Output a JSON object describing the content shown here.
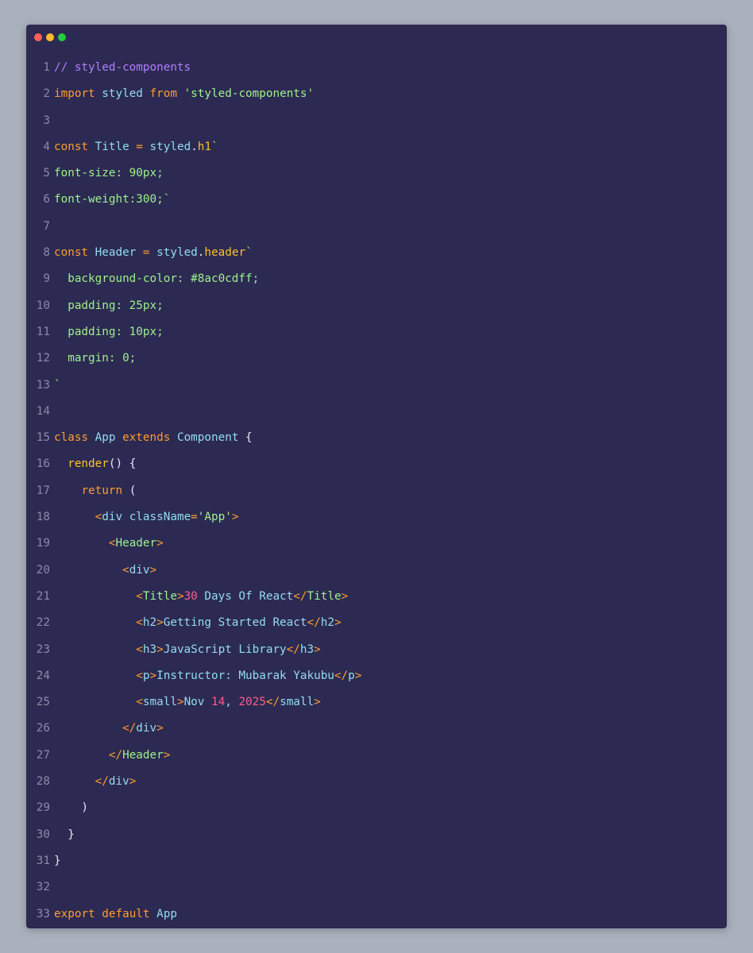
{
  "colors": {
    "background": "#a9b1bd",
    "window": "#2c2a52",
    "line_number": "#8c8aa8",
    "comment": "#b37dff",
    "keyword": "#ff9d2e",
    "identifier": "#94dcf0",
    "string": "#9ff28c",
    "property": "#ffc125",
    "plain": "#e8e8f0",
    "number": "#ff5c8a"
  },
  "window_controls": [
    "close-dot",
    "minimize-dot",
    "maximize-dot"
  ],
  "lines": [
    {
      "n": "1",
      "tokens": [
        {
          "t": "// styled-components",
          "c": "com"
        }
      ]
    },
    {
      "n": "2",
      "tokens": [
        {
          "t": "import",
          "c": "kw"
        },
        {
          "t": " ",
          "c": "plain"
        },
        {
          "t": "styled",
          "c": "id"
        },
        {
          "t": " ",
          "c": "plain"
        },
        {
          "t": "from",
          "c": "kw"
        },
        {
          "t": " ",
          "c": "plain"
        },
        {
          "t": "'styled-components'",
          "c": "str"
        }
      ]
    },
    {
      "n": "3",
      "tokens": []
    },
    {
      "n": "4",
      "tokens": [
        {
          "t": "const",
          "c": "kw"
        },
        {
          "t": " ",
          "c": "plain"
        },
        {
          "t": "Title",
          "c": "id"
        },
        {
          "t": " = ",
          "c": "kw"
        },
        {
          "t": "styled",
          "c": "id"
        },
        {
          "t": ".",
          "c": "plain"
        },
        {
          "t": "h1",
          "c": "prop"
        },
        {
          "t": "`",
          "c": "str"
        }
      ]
    },
    {
      "n": "5",
      "tokens": [
        {
          "t": "font-size: 90px;",
          "c": "str"
        }
      ]
    },
    {
      "n": "6",
      "tokens": [
        {
          "t": "font-weight:300;`",
          "c": "str"
        }
      ]
    },
    {
      "n": "7",
      "tokens": []
    },
    {
      "n": "8",
      "tokens": [
        {
          "t": "const",
          "c": "kw"
        },
        {
          "t": " ",
          "c": "plain"
        },
        {
          "t": "Header",
          "c": "id"
        },
        {
          "t": " = ",
          "c": "kw"
        },
        {
          "t": "styled",
          "c": "id"
        },
        {
          "t": ".",
          "c": "plain"
        },
        {
          "t": "header",
          "c": "prop"
        },
        {
          "t": "`",
          "c": "str"
        }
      ]
    },
    {
      "n": "9",
      "tokens": [
        {
          "t": "  background-color: #8ac0cdff;",
          "c": "str"
        }
      ]
    },
    {
      "n": "10",
      "tokens": [
        {
          "t": "  padding: 25px;",
          "c": "str"
        }
      ]
    },
    {
      "n": "11",
      "tokens": [
        {
          "t": "  padding: 10px;",
          "c": "str"
        }
      ]
    },
    {
      "n": "12",
      "tokens": [
        {
          "t": "  margin: 0;",
          "c": "str"
        }
      ]
    },
    {
      "n": "13",
      "tokens": [
        {
          "t": "`",
          "c": "str"
        }
      ]
    },
    {
      "n": "14",
      "tokens": []
    },
    {
      "n": "15",
      "tokens": [
        {
          "t": "class",
          "c": "kw"
        },
        {
          "t": " ",
          "c": "plain"
        },
        {
          "t": "App",
          "c": "id"
        },
        {
          "t": " ",
          "c": "plain"
        },
        {
          "t": "extends",
          "c": "kw"
        },
        {
          "t": " ",
          "c": "plain"
        },
        {
          "t": "Component",
          "c": "id"
        },
        {
          "t": " {",
          "c": "plain"
        }
      ]
    },
    {
      "n": "16",
      "tokens": [
        {
          "t": "  ",
          "c": "plain"
        },
        {
          "t": "render",
          "c": "prop"
        },
        {
          "t": "() {",
          "c": "plain"
        }
      ]
    },
    {
      "n": "17",
      "tokens": [
        {
          "t": "    ",
          "c": "plain"
        },
        {
          "t": "return",
          "c": "kw"
        },
        {
          "t": " (",
          "c": "plain"
        }
      ]
    },
    {
      "n": "18",
      "tokens": [
        {
          "t": "      ",
          "c": "plain"
        },
        {
          "t": "<",
          "c": "kw"
        },
        {
          "t": "div",
          "c": "id"
        },
        {
          "t": " ",
          "c": "plain"
        },
        {
          "t": "className",
          "c": "id"
        },
        {
          "t": "=",
          "c": "kw"
        },
        {
          "t": "'App'",
          "c": "str"
        },
        {
          "t": ">",
          "c": "kw"
        }
      ]
    },
    {
      "n": "19",
      "tokens": [
        {
          "t": "        ",
          "c": "plain"
        },
        {
          "t": "<",
          "c": "kw"
        },
        {
          "t": "Header",
          "c": "str"
        },
        {
          "t": ">",
          "c": "kw"
        }
      ]
    },
    {
      "n": "20",
      "tokens": [
        {
          "t": "          ",
          "c": "plain"
        },
        {
          "t": "<",
          "c": "kw"
        },
        {
          "t": "div",
          "c": "id"
        },
        {
          "t": ">",
          "c": "kw"
        }
      ]
    },
    {
      "n": "21",
      "tokens": [
        {
          "t": "            ",
          "c": "plain"
        },
        {
          "t": "<",
          "c": "kw"
        },
        {
          "t": "Title",
          "c": "str"
        },
        {
          "t": ">",
          "c": "kw"
        },
        {
          "t": "30",
          "c": "num"
        },
        {
          "t": " Days Of React",
          "c": "id"
        },
        {
          "t": "</",
          "c": "kw"
        },
        {
          "t": "Title",
          "c": "str"
        },
        {
          "t": ">",
          "c": "kw"
        }
      ]
    },
    {
      "n": "22",
      "tokens": [
        {
          "t": "            ",
          "c": "plain"
        },
        {
          "t": "<",
          "c": "kw"
        },
        {
          "t": "h2",
          "c": "id"
        },
        {
          "t": ">",
          "c": "kw"
        },
        {
          "t": "Getting Started React",
          "c": "id"
        },
        {
          "t": "</",
          "c": "kw"
        },
        {
          "t": "h2",
          "c": "id"
        },
        {
          "t": ">",
          "c": "kw"
        }
      ]
    },
    {
      "n": "23",
      "tokens": [
        {
          "t": "            ",
          "c": "plain"
        },
        {
          "t": "<",
          "c": "kw"
        },
        {
          "t": "h3",
          "c": "id"
        },
        {
          "t": ">",
          "c": "kw"
        },
        {
          "t": "JavaScript Library",
          "c": "id"
        },
        {
          "t": "</",
          "c": "kw"
        },
        {
          "t": "h3",
          "c": "id"
        },
        {
          "t": ">",
          "c": "kw"
        }
      ]
    },
    {
      "n": "24",
      "tokens": [
        {
          "t": "            ",
          "c": "plain"
        },
        {
          "t": "<",
          "c": "kw"
        },
        {
          "t": "p",
          "c": "id"
        },
        {
          "t": ">",
          "c": "kw"
        },
        {
          "t": "Instructor: Mubarak Yakubu",
          "c": "id"
        },
        {
          "t": "</",
          "c": "kw"
        },
        {
          "t": "p",
          "c": "id"
        },
        {
          "t": ">",
          "c": "kw"
        }
      ]
    },
    {
      "n": "25",
      "tokens": [
        {
          "t": "            ",
          "c": "plain"
        },
        {
          "t": "<",
          "c": "kw"
        },
        {
          "t": "small",
          "c": "id"
        },
        {
          "t": ">",
          "c": "kw"
        },
        {
          "t": "Nov ",
          "c": "id"
        },
        {
          "t": "14",
          "c": "num"
        },
        {
          "t": ", ",
          "c": "id"
        },
        {
          "t": "2025",
          "c": "num"
        },
        {
          "t": "</",
          "c": "kw"
        },
        {
          "t": "small",
          "c": "id"
        },
        {
          "t": ">",
          "c": "kw"
        }
      ]
    },
    {
      "n": "26",
      "tokens": [
        {
          "t": "          ",
          "c": "plain"
        },
        {
          "t": "</",
          "c": "kw"
        },
        {
          "t": "div",
          "c": "id"
        },
        {
          "t": ">",
          "c": "kw"
        }
      ]
    },
    {
      "n": "27",
      "tokens": [
        {
          "t": "        ",
          "c": "plain"
        },
        {
          "t": "</",
          "c": "kw"
        },
        {
          "t": "Header",
          "c": "str"
        },
        {
          "t": ">",
          "c": "kw"
        }
      ]
    },
    {
      "n": "28",
      "tokens": [
        {
          "t": "      ",
          "c": "plain"
        },
        {
          "t": "</",
          "c": "kw"
        },
        {
          "t": "div",
          "c": "id"
        },
        {
          "t": ">",
          "c": "kw"
        }
      ]
    },
    {
      "n": "29",
      "tokens": [
        {
          "t": "    )",
          "c": "plain"
        }
      ]
    },
    {
      "n": "30",
      "tokens": [
        {
          "t": "  }",
          "c": "plain"
        }
      ]
    },
    {
      "n": "31",
      "tokens": [
        {
          "t": "}",
          "c": "plain"
        }
      ]
    },
    {
      "n": "32",
      "tokens": []
    },
    {
      "n": "33",
      "tokens": [
        {
          "t": "export",
          "c": "kw"
        },
        {
          "t": " ",
          "c": "plain"
        },
        {
          "t": "default",
          "c": "kw"
        },
        {
          "t": " ",
          "c": "plain"
        },
        {
          "t": "App",
          "c": "id"
        }
      ]
    }
  ]
}
